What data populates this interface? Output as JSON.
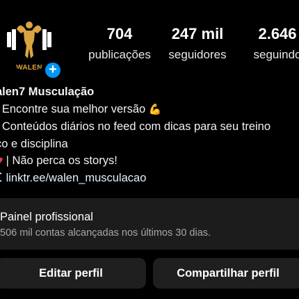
{
  "profile": {
    "avatar_caption": "WALEN",
    "add_story_symbol": "+"
  },
  "stats": [
    {
      "value": "704",
      "label": "publicações"
    },
    {
      "value": "247 mil",
      "label": "seguidores"
    },
    {
      "value": "2.646",
      "label": "seguindo"
    }
  ],
  "bio": {
    "name": "alen7 Musculação",
    "line1": "| Encontre sua melhor versão",
    "line1_emoji": "💪",
    "line2": "| Conteúdos diários no feed com dicas para seu treino",
    "line3": "co e disciplina",
    "line4": "| Não perca os storys!",
    "link": "linktr.ee/walen_musculacao"
  },
  "panel": {
    "title": "Painel profissional",
    "subtitle": "506 mil contas alcançadas nos últimos 30 dias."
  },
  "buttons": {
    "edit": "Editar perfil",
    "share": "Compartilhar perfil"
  },
  "icons": {
    "avatar": "bodybuilder-logo-icon",
    "add": "plus-icon",
    "flex": "flexed-biceps-icon",
    "heart": "heart-icon",
    "link": "link-icon"
  },
  "colors": {
    "background": "#000000",
    "accent": "#0095f6",
    "logo_gold": "#d9a441",
    "panel": "#1c1c1c",
    "button": "#1f1f1f"
  }
}
